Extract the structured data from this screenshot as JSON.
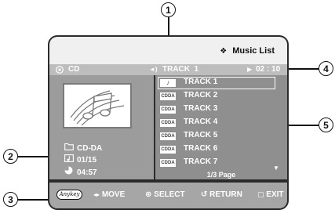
{
  "callouts": {
    "c1": "1",
    "c2": "2",
    "c3": "3",
    "c4": "4",
    "c5": "5"
  },
  "header": {
    "music_list_icon": "❖",
    "music_list": "Music List"
  },
  "status": {
    "disc_icon": "disc-icon",
    "disc": "CD",
    "speaker_icon": "◄)",
    "track": "TRACK  1",
    "play_icon": "▶",
    "time": "02 : 10"
  },
  "info": {
    "type": "CD-DA",
    "track_count": "01/15",
    "total_time": "04:57"
  },
  "tracks": [
    {
      "badge": "♪",
      "name": "TRACK 1",
      "selected": true
    },
    {
      "badge": "CDDA",
      "name": "TRACK 2"
    },
    {
      "badge": "CDDA",
      "name": "TRACK 3"
    },
    {
      "badge": "CDDA",
      "name": "TRACK 4"
    },
    {
      "badge": "CDDA",
      "name": "TRACK 5"
    },
    {
      "badge": "CDDA",
      "name": "TRACK 6"
    },
    {
      "badge": "CDDA",
      "name": "TRACK 7"
    }
  ],
  "scroll_down": "▼",
  "page": "1/3 Page",
  "bottom": {
    "anykey": "Anykey",
    "move_icon": "◂▸",
    "move": "MOVE",
    "select_icon": "⊕",
    "select": "SELECT",
    "return_icon": "↺",
    "return": "RETURN",
    "exit_icon": "▢",
    "exit": "EXIT"
  }
}
